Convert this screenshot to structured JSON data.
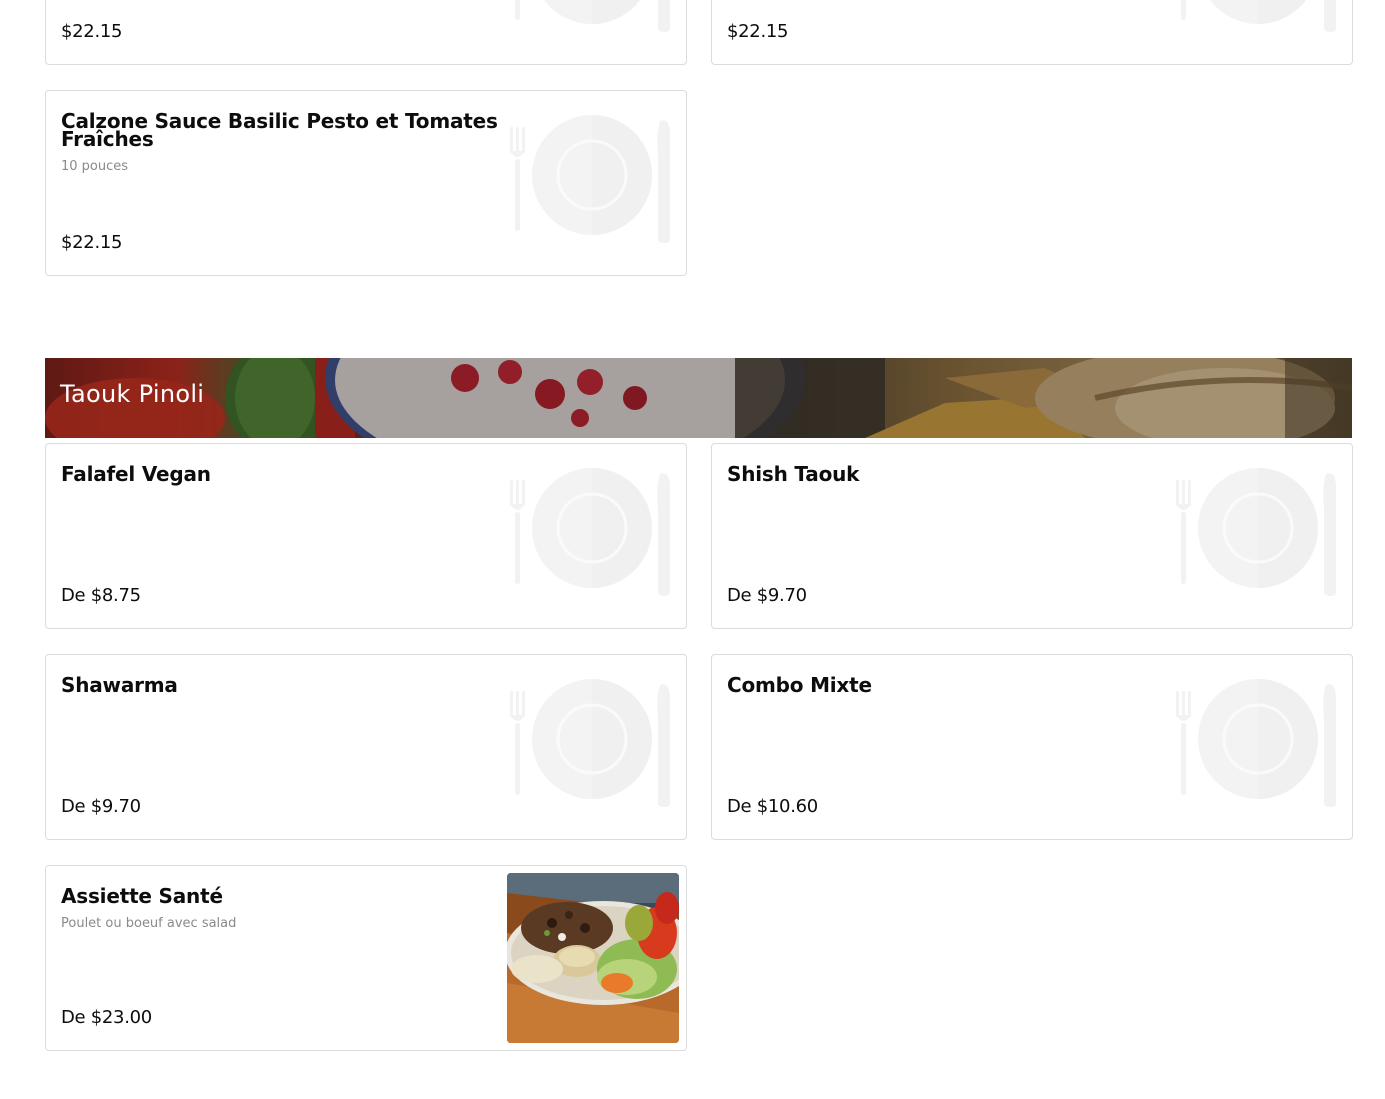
{
  "top_cards": [
    {
      "price": "$22.15"
    },
    {
      "price": "$22.15"
    }
  ],
  "pizza_section": {
    "items": [
      {
        "name": "Calzone Sauce Basilic Pesto et Tomates Fraîches",
        "description": "10 pouces",
        "price": "$22.15"
      }
    ]
  },
  "taouk_section": {
    "title": "Taouk Pinoli",
    "items": [
      {
        "name": "Falafel Vegan",
        "description": "",
        "price": "De $8.75"
      },
      {
        "name": "Shish Taouk",
        "description": "",
        "price": "De $9.70"
      },
      {
        "name": "Shawarma",
        "description": "",
        "price": "De $9.70"
      },
      {
        "name": "Combo Mixte",
        "description": "",
        "price": "De $10.60"
      },
      {
        "name": "Assiette Santé",
        "description": "Poulet ou boeuf avec salad",
        "price": "De $23.00"
      }
    ]
  },
  "icons": {
    "placeholder": "plate-fork-knife-icon"
  },
  "colors": {
    "card_border": "#dcdcdc",
    "price_text": "#0d0d0d",
    "description_text": "#8a8a8a",
    "banner_text": "#ffffff"
  }
}
